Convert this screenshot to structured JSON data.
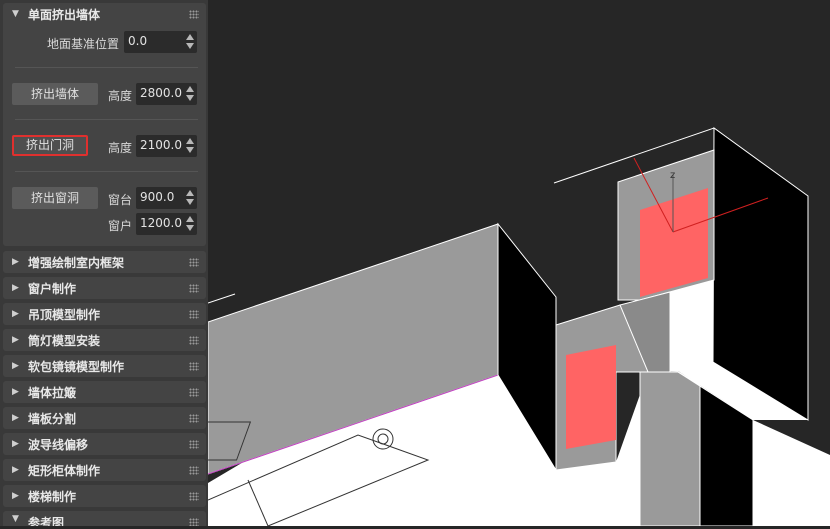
{
  "panel": {
    "main_rollout": {
      "title": "单面挤出墙体",
      "ground_label": "地面基准位置",
      "ground_value": "0.0",
      "wall_button": "挤出墙体",
      "wall_height_label": "高度",
      "wall_height_value": "2800.0",
      "door_button": "挤出门洞",
      "door_height_label": "高度",
      "door_height_value": "2100.0",
      "window_button": "挤出窗洞",
      "sill_label": "窗台",
      "sill_value": "900.0",
      "window_label": "窗户",
      "window_value": "1200.0"
    },
    "rollouts": [
      {
        "title": "增强绘制室内框架"
      },
      {
        "title": "窗户制作"
      },
      {
        "title": "吊顶模型制作"
      },
      {
        "title": "筒灯模型安装"
      },
      {
        "title": "软包镜镜模型制作"
      },
      {
        "title": "墙体拉簸"
      },
      {
        "title": "墙板分割"
      },
      {
        "title": "波导线偏移"
      },
      {
        "title": "矩形柜体制作"
      },
      {
        "title": "楼梯制作"
      },
      {
        "title": "参考图"
      }
    ],
    "highlight_color": "#e0302e"
  },
  "viewport": {
    "gizmo_axis_label": "z",
    "colors": {
      "background": "#262626",
      "wall": "#9a9a9a",
      "wall_dark": "#000000",
      "floor": "#ffffff",
      "opening": "#ff6464"
    }
  }
}
